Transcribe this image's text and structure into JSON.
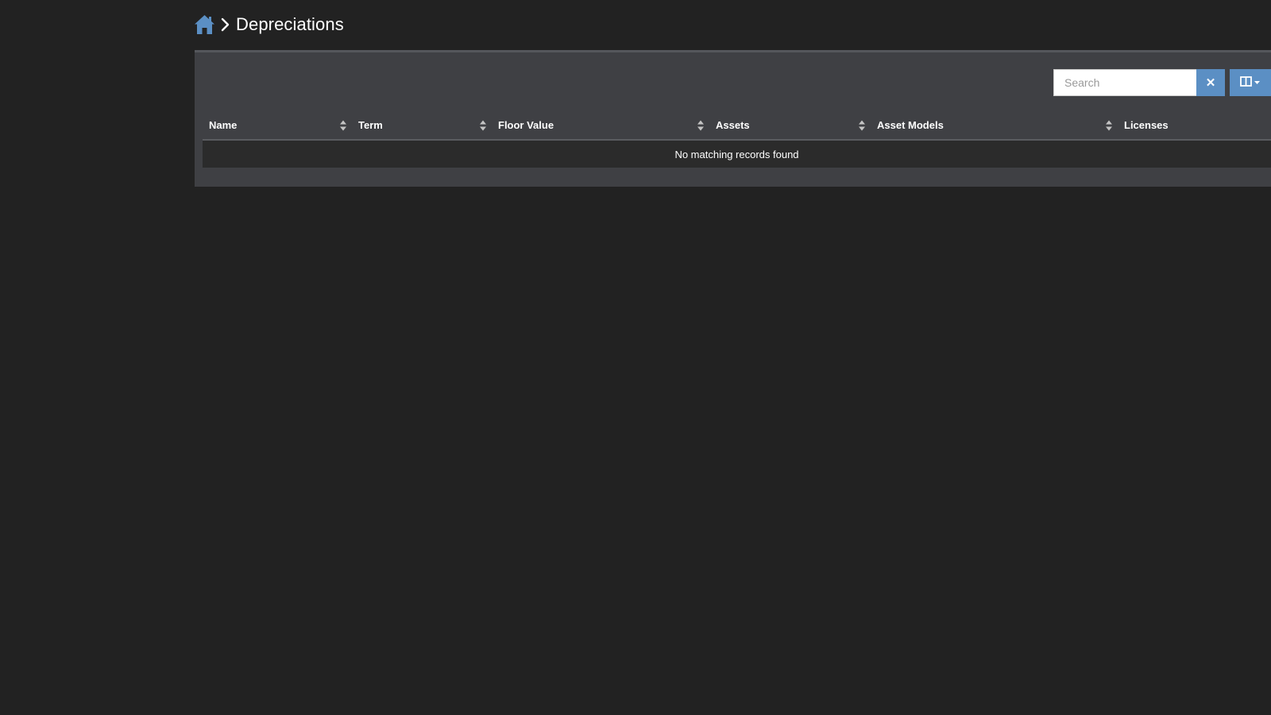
{
  "breadcrumb": {
    "home_icon": "home-icon",
    "separator_icon": "chevron-right-icon",
    "title": "Depreciations"
  },
  "toolbar": {
    "search_placeholder": "Search",
    "search_value": "",
    "clear_label": "✕",
    "columns_icon": "columns-icon"
  },
  "table": {
    "columns": [
      {
        "label": "Name"
      },
      {
        "label": "Term"
      },
      {
        "label": "Floor Value"
      },
      {
        "label": "Assets"
      },
      {
        "label": "Asset Models"
      },
      {
        "label": "Licenses"
      }
    ],
    "empty_message": "No matching records found"
  },
  "colors": {
    "background": "#222222",
    "panel": "#3f4044",
    "accent": "#5b8fc4",
    "row": "#2b2b2b"
  }
}
